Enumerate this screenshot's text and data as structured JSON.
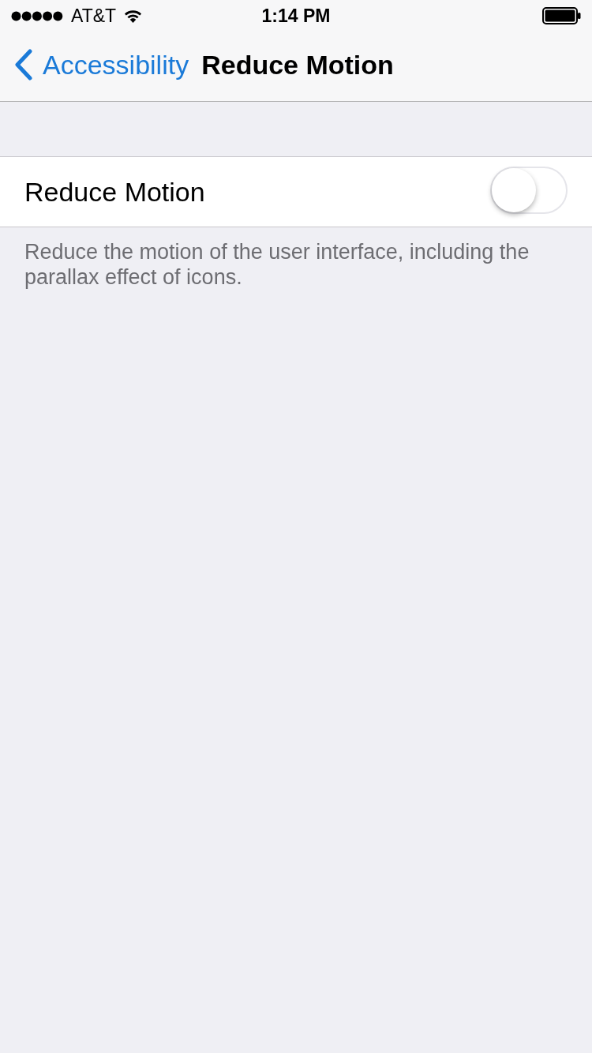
{
  "status_bar": {
    "carrier": "AT&T",
    "time": "1:14 PM"
  },
  "nav_bar": {
    "back_label": "Accessibility",
    "title": "Reduce Motion"
  },
  "settings": [
    {
      "label": "Reduce Motion",
      "on": false
    }
  ],
  "footer": "Reduce the motion of the user interface, including the parallax effect of icons."
}
